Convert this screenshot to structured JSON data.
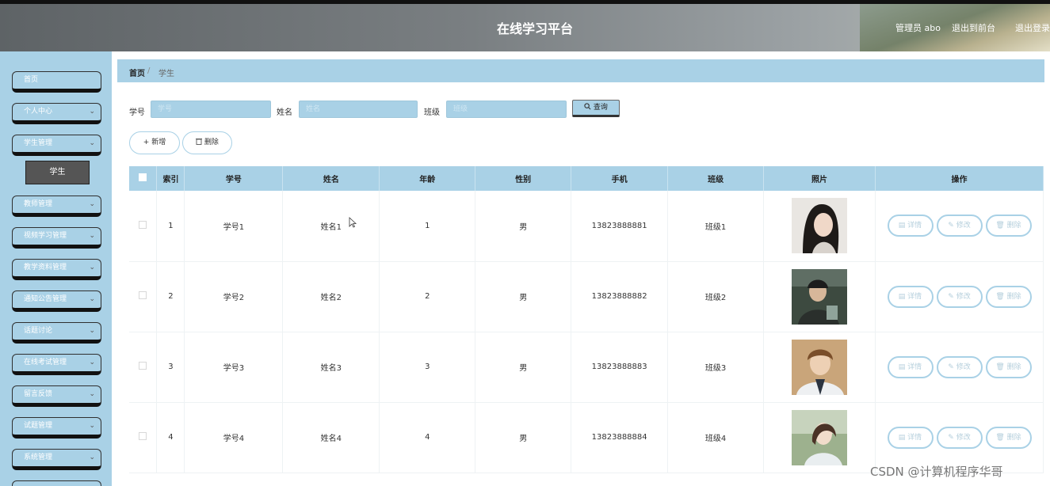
{
  "header": {
    "title": "在线学习平台",
    "user": "管理员 abo",
    "to_front": "退出到前台",
    "logout": "退出登录"
  },
  "sidebar": {
    "items": [
      {
        "label": "首页",
        "chevron": ""
      },
      {
        "label": "个人中心",
        "chevron": "⌄"
      },
      {
        "label": "学生管理",
        "chevron": "⌄"
      },
      {
        "label": "教师管理",
        "chevron": "⌄"
      },
      {
        "label": "视频学习管理",
        "chevron": "⌄"
      },
      {
        "label": "教学资料管理",
        "chevron": "⌄"
      },
      {
        "label": "通知公告管理",
        "chevron": "⌄"
      },
      {
        "label": "话题讨论",
        "chevron": "⌄"
      },
      {
        "label": "在线考试管理",
        "chevron": "⌄"
      },
      {
        "label": "留言反馈",
        "chevron": "⌄"
      },
      {
        "label": "试题管理",
        "chevron": "⌄"
      },
      {
        "label": "系统管理",
        "chevron": "⌄"
      }
    ],
    "sub_item": "学生"
  },
  "breadcrumb": {
    "home": "首页",
    "separator": "/",
    "current": "学生"
  },
  "search": {
    "student_no_label": "学号",
    "student_no_placeholder": "学号",
    "name_label": "姓名",
    "name_placeholder": "姓名",
    "class_label": "班级",
    "class_placeholder": "班级",
    "button": "查询"
  },
  "actions": {
    "add": "新增",
    "delete": "删除"
  },
  "table": {
    "columns": [
      "索引",
      "学号",
      "姓名",
      "年龄",
      "性别",
      "手机",
      "班级",
      "照片",
      "操作"
    ],
    "rows": [
      {
        "index": "1",
        "student_no": "学号1",
        "name": "姓名1",
        "age": "1",
        "gender": "男",
        "phone": "13823888881",
        "class": "班级1"
      },
      {
        "index": "2",
        "student_no": "学号2",
        "name": "姓名2",
        "age": "2",
        "gender": "男",
        "phone": "13823888882",
        "class": "班级2"
      },
      {
        "index": "3",
        "student_no": "学号3",
        "name": "姓名3",
        "age": "3",
        "gender": "男",
        "phone": "13823888883",
        "class": "班级3"
      },
      {
        "index": "4",
        "student_no": "学号4",
        "name": "姓名4",
        "age": "4",
        "gender": "男",
        "phone": "13823888884",
        "class": "班级4"
      }
    ],
    "ops": {
      "detail": "详情",
      "edit": "修改",
      "delete": "删除"
    }
  },
  "watermark": "CSDN @计算机程序华哥",
  "colors": {
    "accent": "#a9d1e6",
    "header": "#7a7f82",
    "sub_active": "#555555"
  }
}
